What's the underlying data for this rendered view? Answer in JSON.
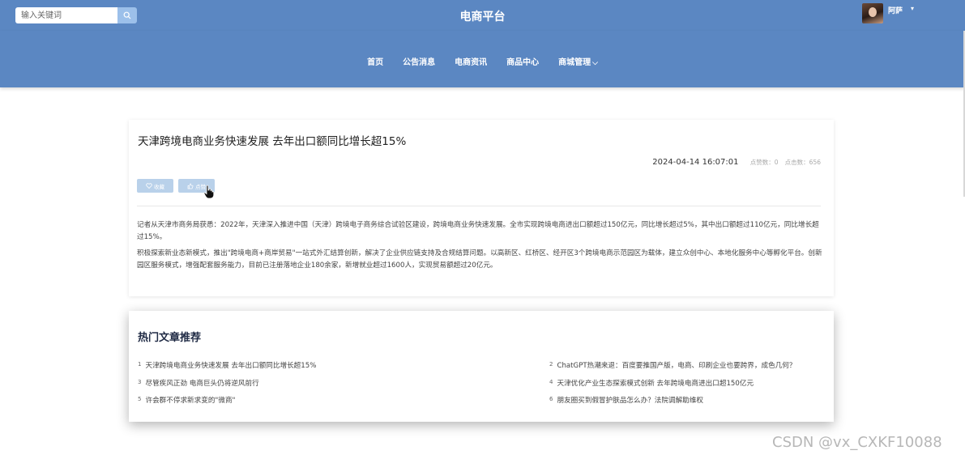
{
  "search": {
    "placeholder": "输入关键词"
  },
  "header": {
    "site_title": "电商平台",
    "user_name": "阿萨"
  },
  "nav": {
    "items": [
      "首页",
      "公告消息",
      "电商资讯",
      "商品中心",
      "商城管理"
    ]
  },
  "article": {
    "title": "天津跨境电商业务快速发展 去年出口额同比增长超15%",
    "date": "2024-04-14 16:07:01",
    "likes_label": "点赞数：0",
    "clicks_label": "点击数：656",
    "fav_button": "收藏",
    "like_button": "点赞",
    "paragraphs": [
      "记者从天津市商务局获悉：2022年，天津深入推进中国（天津）跨境电子商务综合试验区建设，跨境电商业务快速发展。全市实现跨境电商进出口额超过150亿元，同比增长超过5%，其中出口额超过110亿元，同比增长超过15%。",
      "积极探索新业态新模式，推出\"跨境电商+商岸贸易\"一站式外汇结算创新，解决了企业供应链支持及合规结算问题。以高新区、红桥区、经开区3个跨境电商示范园区为载体，建立众创中心、本地化服务中心等孵化平台。创新园区服务模式，增强配套服务能力，目前已注册落地企业180余家，新增就业超过1600人，实现贸易额超过20亿元。"
    ]
  },
  "hot": {
    "title": "热门文章推荐",
    "items": [
      {
        "num": "1",
        "text": "天津跨境电商业务快速发展 去年出口额同比增长超15%"
      },
      {
        "num": "2",
        "text": "ChatGPT热潮来退：百度要推国产版，电商、印刷企业也要跨界，成色几何？"
      },
      {
        "num": "3",
        "text": "尽管疾风正劲 电商巨头仍将逆风前行"
      },
      {
        "num": "4",
        "text": "天津优化产业生态探索模式创新 去年跨境电商进出口超150亿元"
      },
      {
        "num": "5",
        "text": "许会群不停求新求变的\"微商\""
      },
      {
        "num": "6",
        "text": "朋友圈买到假冒护肤品怎么办？法院调解助维权"
      }
    ]
  },
  "watermark": "CSDN @vx_CXKF10088",
  "colors": {
    "header_bg": "#5b87c2",
    "button_light": "#b9d1ea",
    "search_btn": "#9cc0ea"
  },
  "icons": {
    "search": "search-icon",
    "heart": "heart-icon",
    "thumb": "thumbs-up-icon",
    "caret": "caret-down-icon"
  }
}
